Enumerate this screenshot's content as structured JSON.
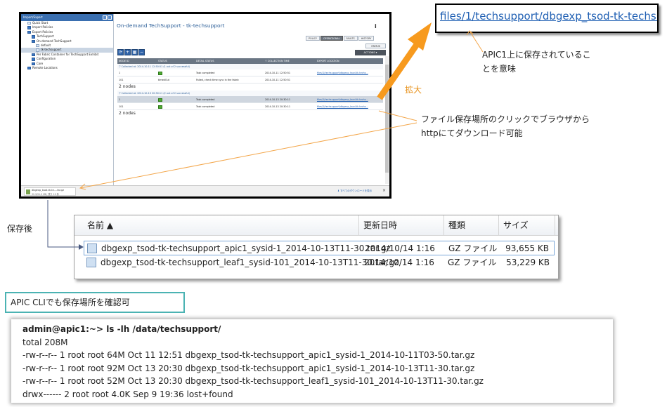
{
  "apic": {
    "sidebar_title": "Import/Export",
    "tree": [
      {
        "label": "Quick Start",
        "indent": 1,
        "icon": "doc"
      },
      {
        "label": "Import Policies",
        "indent": 1,
        "icon": "folder"
      },
      {
        "label": "Export Policies",
        "indent": 1,
        "icon": "folder"
      },
      {
        "label": "TechSupport",
        "indent": 2,
        "icon": "folder"
      },
      {
        "label": "On-demand TechSupport",
        "indent": 2,
        "icon": "folder"
      },
      {
        "label": "default",
        "indent": 3,
        "icon": "doc"
      },
      {
        "label": "tk-techsupport",
        "indent": 3,
        "icon": "doc",
        "selected": true
      },
      {
        "label": "Per Fabric Container for TechSupport Exhibit",
        "indent": 2,
        "icon": "folder"
      },
      {
        "label": "Configuration",
        "indent": 2,
        "icon": "folder"
      },
      {
        "label": "Core",
        "indent": 2,
        "icon": "folder"
      },
      {
        "label": "Remote Locations",
        "indent": 1,
        "icon": "folder"
      }
    ],
    "content_title": "On-demand TechSupport - tk-techsupport",
    "info_icon": "i",
    "view_tabs": [
      "POLICY",
      "OPERATIONAL",
      "FAULTS",
      "HISTORY"
    ],
    "status_tab": "STATUS",
    "toolbar": [
      "⟳",
      "+",
      "▦",
      "−"
    ],
    "actions_label": "ACTIONS",
    "table_headers": [
      "NODE ID",
      "STATUS",
      "DETAIL STATUS",
      "↑ COLLECTION TIME",
      "EXPORT LOCATION"
    ],
    "groups": [
      {
        "label": "▽ Collected at: 2014-10-11 12:50:51 (1 out of 2 successful)",
        "rows": [
          {
            "node": "1",
            "status": "ok",
            "detail": "Task completed",
            "time": "2014-10-11 12:50:51",
            "location": "files/1/techsupport/dbgexp_tsod-tk-techs...",
            "highlight": false
          },
          {
            "node": "101",
            "status": "timedOut",
            "detail": "Failed, check time sync in the fabric",
            "time": "2014-10-11 12:50:51",
            "location": "",
            "highlight": false
          }
        ],
        "nodes_label": "2 nodes"
      },
      {
        "label": "▽ Collected at: 2014-10-13 20:30:11 (2 out of 2 successful)",
        "rows": [
          {
            "node": "1",
            "status": "ok",
            "detail": "Task completed",
            "time": "2014-10-13 20:30:11",
            "location": "files/1/techsupport/dbgexp_tsod-tk-techs...",
            "highlight": true
          },
          {
            "node": "101",
            "status": "ok",
            "detail": "Task completed",
            "time": "2014-10-13 20:30:11",
            "location": "files/1/techsupport/dbgexp_tsod-tk-techs...",
            "highlight": false
          }
        ],
        "nodes_label": "2 nodes"
      }
    ],
    "download": {
      "name": "dbgexp_tsod-tk-te....tar.gz",
      "size": "32.9/91.5 MB, 残り 19 秒",
      "show_all": "⬇ すべてのダウンロードを表示",
      "close": "×"
    }
  },
  "zoom": {
    "link_text": "files/1/techsupport/dbgexp_tsod-tk-techs..."
  },
  "annotations": {
    "apic_saved_line1": "APIC1上に保存されているこ",
    "apic_saved_line2": "とを意味",
    "zoom_label": "拡大",
    "download_line1": "ファイル保存場所のクリックでブラウザから",
    "download_line2": "httpにてダウンロード可能",
    "after_save": "保存後",
    "cli_label": "APIC CLIでも保存場所を確認可"
  },
  "explorer": {
    "columns": [
      "名前 ▲",
      "更新日時",
      "種類",
      "サイズ"
    ],
    "files": [
      {
        "name": "dbgexp_tsod-tk-techsupport_apic1_sysid-1_2014-10-13T11-30.tar.gz",
        "date": "2014/10/14 1:16",
        "type": "GZ ファイル",
        "size": "93,655 KB",
        "selected": true
      },
      {
        "name": "dbgexp_tsod-tk-techsupport_leaf1_sysid-101_2014-10-13T11-30.tar.gz",
        "date": "2014/10/14 1:16",
        "type": "GZ ファイル",
        "size": "53,229 KB",
        "selected": false
      }
    ]
  },
  "cli": {
    "lines": [
      "admin@apic1:~> ls -lh /data/techsupport/",
      "total 208M",
      "-rw-r--r-- 1 root root  64M Oct 11 12:51 dbgexp_tsod-tk-techsupport_apic1_sysid-1_2014-10-11T03-50.tar.gz",
      "-rw-r--r-- 1 root root  92M Oct 13 20:30 dbgexp_tsod-tk-techsupport_apic1_sysid-1_2014-10-13T11-30.tar.gz",
      "-rw-r--r-- 1 root root  52M Oct 13 20:30 dbgexp_tsod-tk-techsupport_leaf1_sysid-101_2014-10-13T11-30.tar.gz",
      "drwx------ 2 root root 4.0K Sep  9 19:36 lost+found"
    ]
  },
  "colors": {
    "orange_arrow": "#f79a1e",
    "link_blue": "#1f5fb3",
    "cli_label_border": "#4bb3b3"
  }
}
